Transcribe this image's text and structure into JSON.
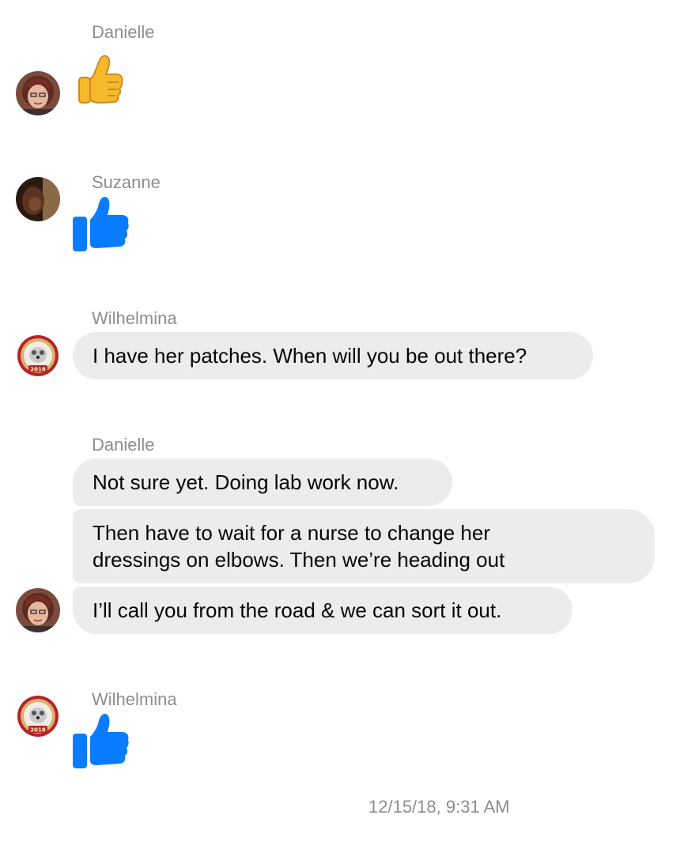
{
  "messages": [
    {
      "sender": "Danielle",
      "type": "emoji",
      "emoji": "thumbs-up-emoji"
    },
    {
      "sender": "Suzanne",
      "type": "like",
      "icon": "like-thumb-icon"
    },
    {
      "sender": "Wilhelmina",
      "type": "text",
      "text": "I have her patches. When will you be out there?"
    },
    {
      "sender": "Danielle",
      "type": "text-group",
      "bubbles": [
        {
          "text": "Not sure yet. Doing lab work now."
        },
        {
          "line1": "Then have to wait for a nurse to change her",
          "line2": "dressings on elbows. Then we’re heading out"
        },
        {
          "text": "I’ll call you from the road & we can sort it out."
        }
      ]
    },
    {
      "sender": "Wilhelmina",
      "type": "like",
      "icon": "like-thumb-icon"
    }
  ],
  "avatars": {
    "wilhelmina_badge_year": "2018"
  },
  "timestamp": "12/15/18, 9:31 AM",
  "colors": {
    "like_blue": "#0a7cff",
    "bubble_gray": "#ececee",
    "meta_gray": "#8a8d91"
  }
}
